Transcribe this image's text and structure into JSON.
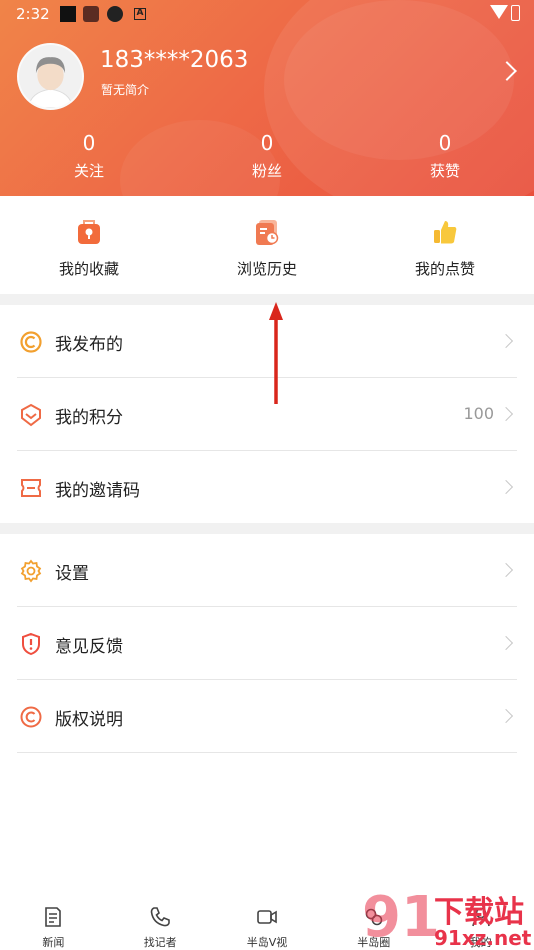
{
  "status_bar": {
    "time": "2:32"
  },
  "profile": {
    "username": "183****2063",
    "bio": "暂无简介"
  },
  "stats": [
    {
      "value": "0",
      "label": "关注"
    },
    {
      "value": "0",
      "label": "粉丝"
    },
    {
      "value": "0",
      "label": "获赞"
    }
  ],
  "quick_actions": [
    {
      "label": "我的收藏",
      "icon": "bookmark-icon"
    },
    {
      "label": "浏览历史",
      "icon": "history-icon"
    },
    {
      "label": "我的点赞",
      "icon": "thumbs-up-icon"
    }
  ],
  "menu_group_1": [
    {
      "label": "我发布的",
      "value": "",
      "icon": "publish-icon"
    },
    {
      "label": "我的积分",
      "value": "100",
      "icon": "points-icon"
    },
    {
      "label": "我的邀请码",
      "value": "",
      "icon": "ticket-icon"
    }
  ],
  "menu_group_2": [
    {
      "label": "设置",
      "icon": "gear-icon"
    },
    {
      "label": "意见反馈",
      "icon": "feedback-shield-icon"
    },
    {
      "label": "版权说明",
      "icon": "copyright-icon"
    }
  ],
  "bottom_nav": [
    {
      "label": "新闻",
      "icon": "news-icon"
    },
    {
      "label": "找记者",
      "icon": "phone-icon"
    },
    {
      "label": "半岛V视",
      "icon": "video-icon"
    },
    {
      "label": "半岛圈",
      "icon": "circle-icon"
    },
    {
      "label": "我的",
      "icon": "user-icon"
    }
  ],
  "watermark": {
    "text_top": "下载站",
    "text_bottom": "91xz.net",
    "logo_mark": "91"
  },
  "colors": {
    "header_start": "#f08448",
    "header_end": "#e9503d",
    "accent": "#f0683f",
    "annotation_arrow": "#d9261c"
  }
}
